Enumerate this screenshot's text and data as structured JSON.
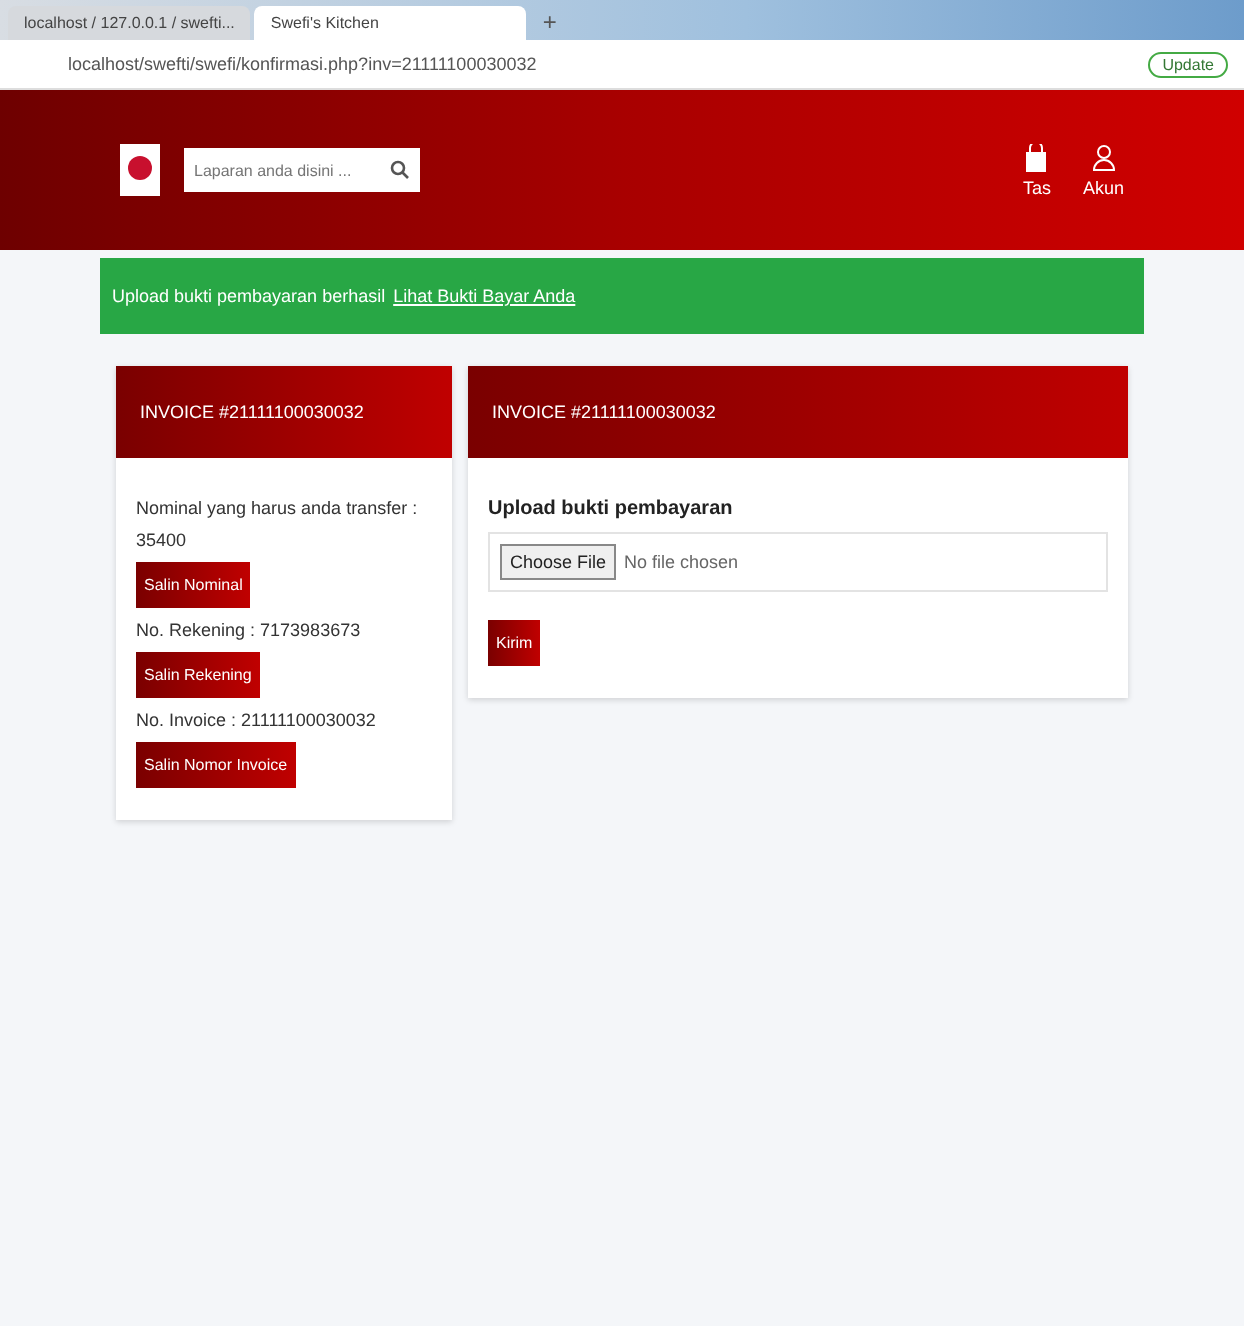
{
  "browser": {
    "tabs": [
      {
        "title": "localhost / 127.0.0.1 / swefti...",
        "selected": false
      },
      {
        "title": "Swefi's Kitchen",
        "selected": true
      }
    ],
    "new_tab": "+",
    "url": "localhost/swefti/swefi/konfirmasi.php?inv=21111100030032",
    "update_button": "Update"
  },
  "navbar": {
    "search": {
      "placeholder": "Laparan anda disini ..."
    },
    "items": [
      {
        "label": "Tas",
        "kind": "bag"
      },
      {
        "label": "Akun",
        "kind": "user"
      }
    ]
  },
  "alert": {
    "message": "Upload bukti pembayaran berhasil",
    "link": "Lihat Bukti Bayar Anda"
  },
  "invoice_card": {
    "title": "INVOICE #21111100030032",
    "lines": [
      {
        "kind": "text",
        "text": "Nominal yang harus anda transfer :"
      },
      {
        "kind": "text",
        "text": "35400"
      },
      {
        "kind": "button",
        "text": "Salin Nominal"
      },
      {
        "kind": "text",
        "text": "No. Rekening : 7173983673"
      },
      {
        "kind": "button",
        "text": "Salin Rekening"
      },
      {
        "kind": "text",
        "text": "No. Invoice : 21111100030032"
      },
      {
        "kind": "button",
        "text": "Salin Nomor Invoice"
      }
    ]
  },
  "upload_card": {
    "title": "INVOICE #21111100030032",
    "label": "Upload bukti pembayaran",
    "file_button": "Choose File",
    "file_status": "No file chosen",
    "submit": "Kirim"
  }
}
